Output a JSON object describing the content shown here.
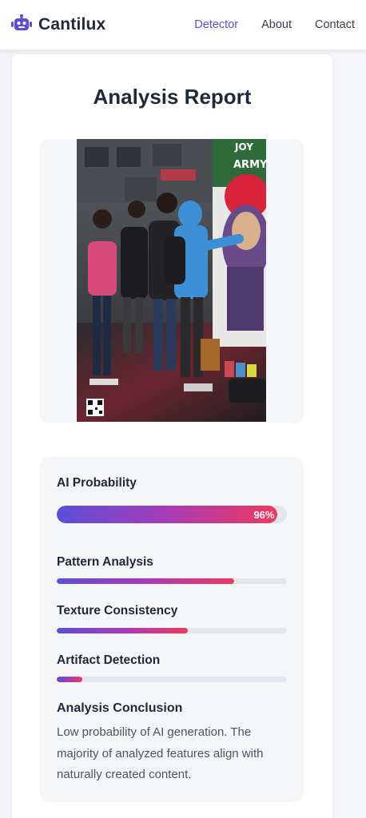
{
  "header": {
    "brand": "Cantilux",
    "nav": [
      {
        "label": "Detector",
        "active": true
      },
      {
        "label": "About",
        "active": false
      },
      {
        "label": "Contact",
        "active": false
      }
    ],
    "logo_icon": "robot-icon",
    "accent_color": "#5b4fd6"
  },
  "report": {
    "title": "Analysis Report",
    "image": {
      "mural_text_line1": "JOY",
      "mural_text_line2": "ARMY"
    },
    "metrics": [
      {
        "label": "AI Probability",
        "percent": 96,
        "value_label": "96%"
      },
      {
        "label": "Pattern Analysis",
        "percent": 77
      },
      {
        "label": "Texture Consistency",
        "percent": 57
      },
      {
        "label": "Artifact Detection",
        "percent": 11
      }
    ],
    "conclusion": {
      "title": "Analysis Conclusion",
      "text": "Low probability of AI generation. The majority of analyzed features align with naturally created content."
    },
    "gradient_colors": [
      "#5b4fd6",
      "#a73bb8",
      "#ef3a5d"
    ]
  }
}
